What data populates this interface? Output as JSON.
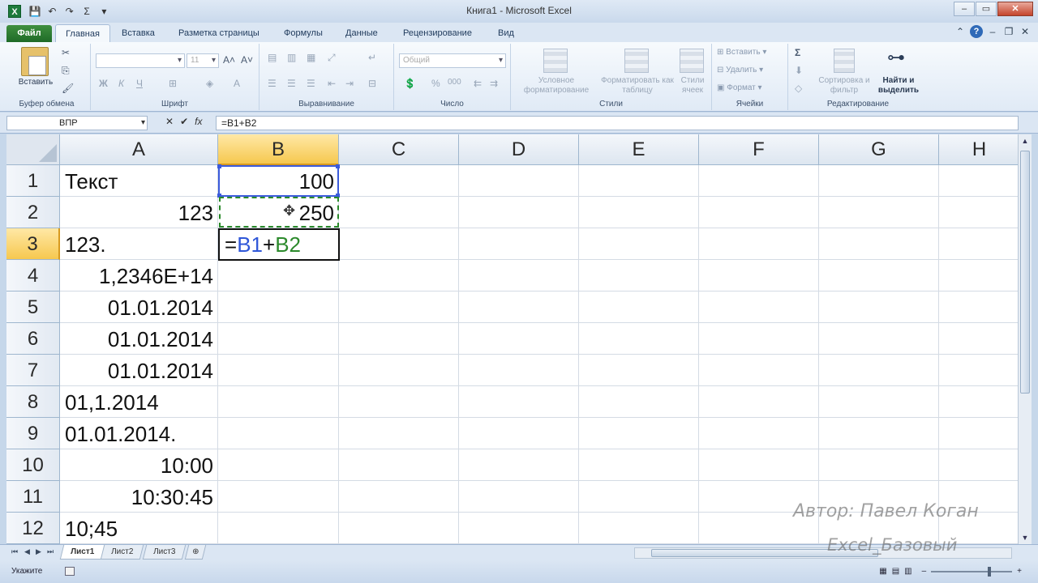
{
  "window": {
    "title": "Книга1 - Microsoft Excel",
    "app_icon_letter": "X",
    "min": "–",
    "max": "▭",
    "close": "✕"
  },
  "qat": {
    "save": "💾",
    "undo": "↶",
    "redo": "↷",
    "sum": "Σ",
    "more": "▾"
  },
  "tabs": [
    "Файл",
    "Главная",
    "Вставка",
    "Разметка страницы",
    "Формулы",
    "Данные",
    "Рецензирование",
    "Вид"
  ],
  "ribbon": {
    "clipboard": {
      "label": "Буфер обмена",
      "paste": "Вставить"
    },
    "font": {
      "label": "Шрифт",
      "font_name": "",
      "font_size": "11",
      "bold": "Ж",
      "italic": "К",
      "underline": "Ч",
      "grow": "A˄",
      "shrink": "A˅"
    },
    "alignment": {
      "label": "Выравнивание"
    },
    "number": {
      "label": "Число",
      "format": "Общий",
      "percent": "%",
      "thousands": "000"
    },
    "styles": {
      "label": "Стили",
      "conditional": "Условное форматирование",
      "as_table": "Форматировать как таблицу",
      "cell_styles": "Стили ячеек"
    },
    "cells": {
      "label": "Ячейки",
      "insert": "Вставить",
      "delete": "Удалить",
      "format": "Формат"
    },
    "editing": {
      "label": "Редактирование",
      "sort": "Сортировка и фильтр",
      "find": "Найти и выделить",
      "sum": "Σ"
    }
  },
  "formula_bar": {
    "name_box": "ВПР",
    "cancel": "✕",
    "enter": "✔",
    "fx": "fx",
    "formula": "=B1+B2"
  },
  "grid": {
    "columns": [
      "A",
      "B",
      "C",
      "D",
      "E",
      "F",
      "G",
      "H"
    ],
    "rows": [
      "1",
      "2",
      "3",
      "4",
      "5",
      "6",
      "7",
      "8",
      "9",
      "10",
      "11",
      "12"
    ],
    "cells_a": [
      {
        "text": "Текст",
        "align": "left"
      },
      {
        "text": "123",
        "align": "right"
      },
      {
        "text": "123.",
        "align": "left"
      },
      {
        "text": "1,2346E+14",
        "align": "right"
      },
      {
        "text": "01.01.2014",
        "align": "right"
      },
      {
        "text": "01.01.2014",
        "align": "right"
      },
      {
        "text": "01.01.2014",
        "align": "right"
      },
      {
        "text": "01,1.2014",
        "align": "left"
      },
      {
        "text": "01.01.2014.",
        "align": "left"
      },
      {
        "text": "10:00",
        "align": "right"
      },
      {
        "text": "10:30:45",
        "align": "right"
      },
      {
        "text": "10;45",
        "align": "left"
      }
    ],
    "b1": "100",
    "b2": "250",
    "b3_eq": "=",
    "b3_ref1": "B1",
    "b3_plus": "+",
    "b3_ref2": "B2",
    "active_column": "B",
    "active_row": "3"
  },
  "sheets": [
    "Лист1",
    "Лист2",
    "Лист3"
  ],
  "status": {
    "text": "Укажите",
    "zoom": "",
    "zoom_minus": "–",
    "zoom_plus": "+"
  },
  "watermark": {
    "author": "Автор: Павел Коган",
    "course": "Excel_Базовый"
  },
  "colors": {
    "ref_b1": "#2f57d8",
    "ref_b2": "#2c8a2c",
    "active_header": "#f6c84f",
    "file_tab": "#1f6b27"
  }
}
